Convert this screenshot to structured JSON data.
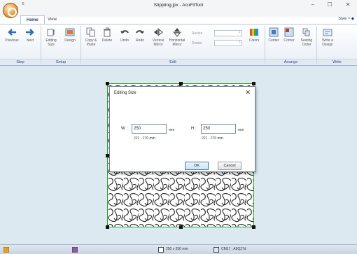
{
  "window": {
    "title": "Stippling.jpx - AcuFilTool",
    "controls": {
      "minimize": "–",
      "maximize": "☐",
      "close": "✕"
    }
  },
  "qat": {
    "icon": "≡"
  },
  "tabs": [
    {
      "label": "Home",
      "active": true
    },
    {
      "label": "View",
      "active": false
    }
  ],
  "style_menu": "Style ˅ ◆",
  "ribbon": {
    "buttons": {
      "previous": "Previous",
      "next": "Next",
      "editing_size": "Editing Size",
      "design": "Design",
      "copy_paste": "Copy & Paste",
      "delete": "Delete",
      "undo": "Undo",
      "redo": "Redo",
      "vertical_mirror": "Vertical Mirror",
      "horizontal_mirror": "Horizontal Mirror",
      "resize": "Resize",
      "rotate": "Rotate",
      "colors": "Colors",
      "center": "Center",
      "corner": "Corner",
      "sewing_order": "Sewing Order",
      "write_design": "Write a Design"
    },
    "groups": {
      "step": "Step",
      "setup": "Setup",
      "edit": "Edit",
      "arrange": "Arrange",
      "write": "Write"
    }
  },
  "dialog": {
    "title": "Editing Size",
    "close": "✕",
    "width_label": "W :",
    "width_value": "250",
    "width_unit": "mm",
    "width_range": "221 - 270 mm",
    "height_label": "H :",
    "height_value": "250",
    "height_unit": "mm",
    "height_range": "221 - 270 mm",
    "ok_label": "OK",
    "cancel_label": "Cancel"
  },
  "status": {
    "hoop_size": "250 x 250 mm",
    "hoop_model": "CM17 : A5Q27d"
  }
}
